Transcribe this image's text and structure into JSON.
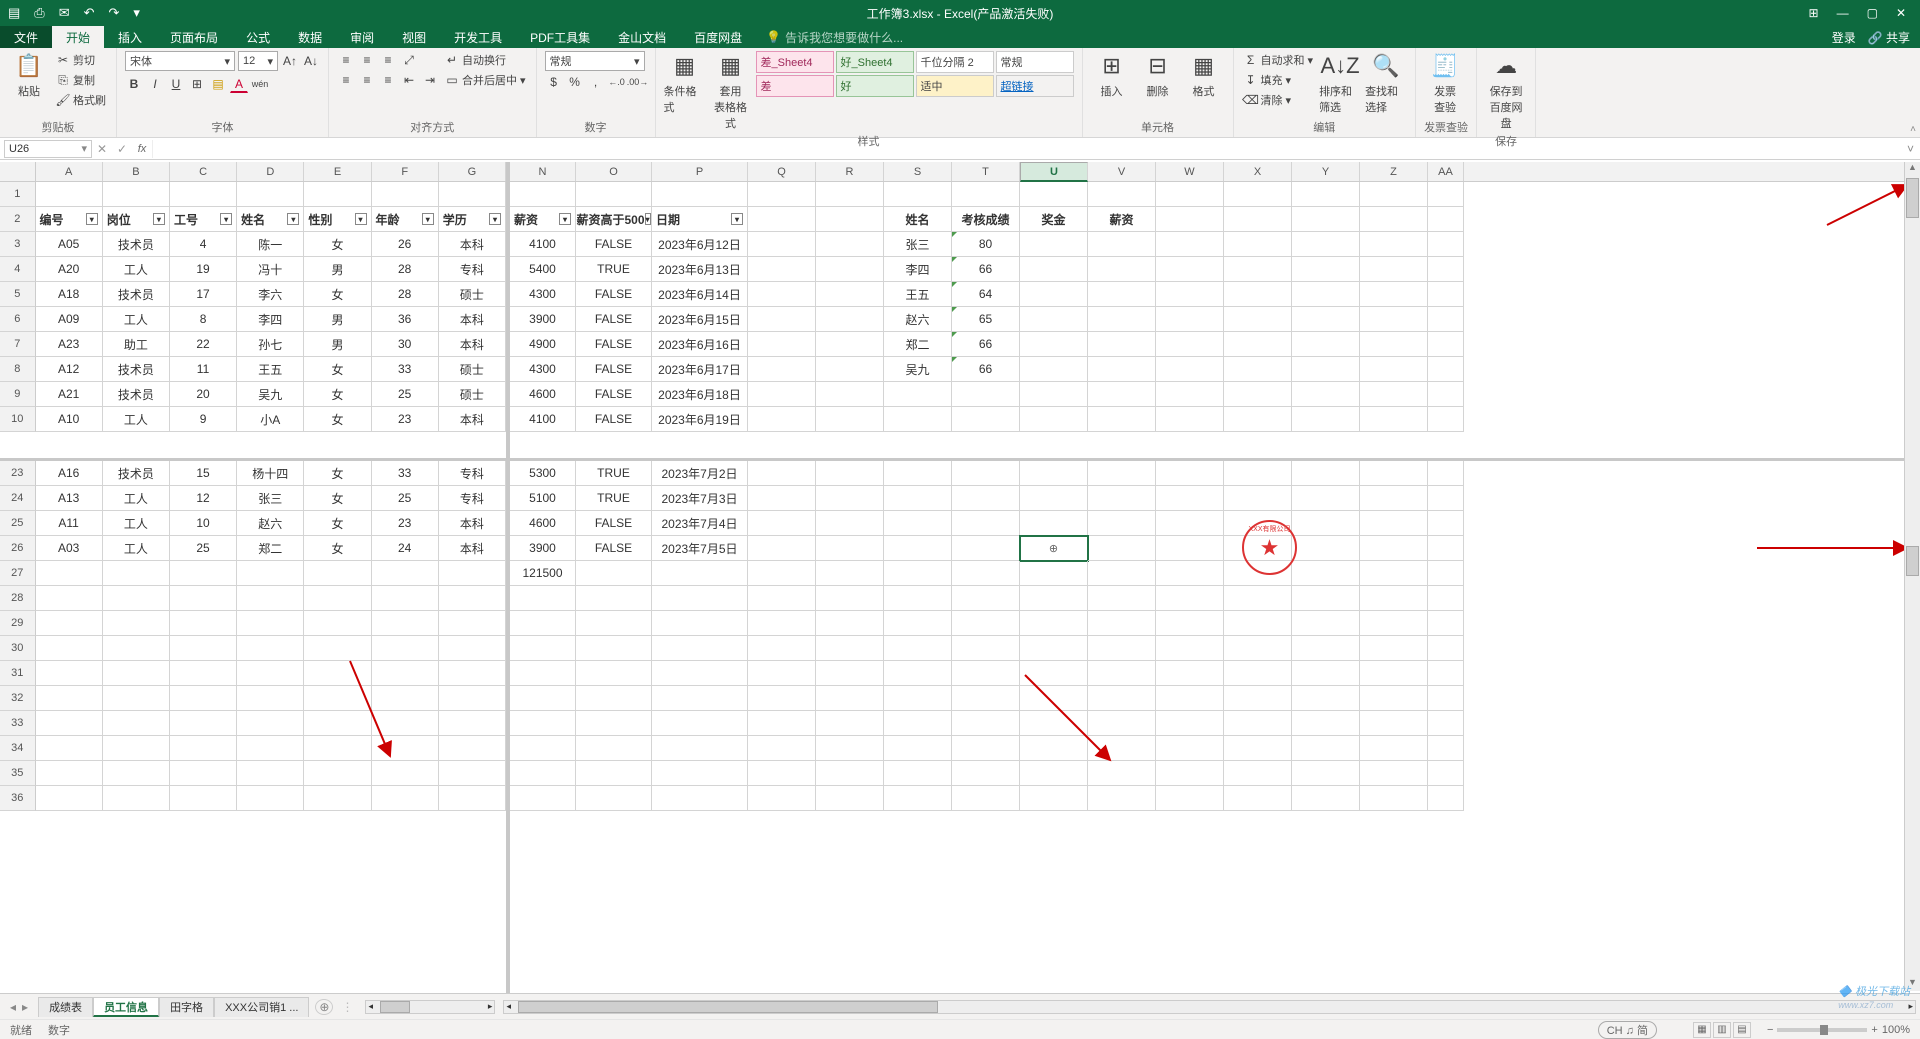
{
  "app": {
    "title": "工作簿3.xlsx - Excel(产品激活失败)",
    "qa_save": "▤",
    "qa_touch": "⎙",
    "qa_print": "✉",
    "qa_undo": "↶",
    "qa_redo": "↷",
    "qa_more": "▾",
    "win_ribbonopt": "⊞",
    "win_min": "—",
    "win_max": "▢",
    "win_close": "✕"
  },
  "tabs": {
    "file": "文件",
    "home": "开始",
    "insert": "插入",
    "layout": "页面布局",
    "formula": "公式",
    "data": "数据",
    "review": "审阅",
    "view": "视图",
    "dev": "开发工具",
    "pdf": "PDF工具集",
    "kingsoft": "金山文档",
    "baidu": "百度网盘",
    "tell_icon": "💡",
    "tell_placeholder": "告诉我您想要做什么...",
    "login": "登录",
    "share": "共享"
  },
  "ribbon": {
    "clipboard": {
      "paste": "粘贴",
      "cut": "剪切",
      "copy": "复制",
      "painter": "格式刷",
      "label": "剪贴板"
    },
    "font": {
      "name": "宋体",
      "size": "12",
      "bold": "B",
      "italic": "I",
      "underline": "U",
      "border": "⊞",
      "fill": "▤",
      "color": "A",
      "inc": "A↑",
      "dec": "A↓",
      "pinyin": "拼音",
      "label": "字体"
    },
    "align": {
      "wrap": "自动换行",
      "merge": "合并后居中",
      "label": "对齐方式"
    },
    "number": {
      "fmt": "常规",
      "cur": "$",
      "pct": "%",
      "comma": ",",
      "inc": ".0",
      "dec": ".00",
      "label": "数字"
    },
    "styles": {
      "cond": "条件格式",
      "astable": "套用\n表格格式",
      "s1": "差_Sheet4",
      "s2": "好_Sheet4",
      "s3": "千位分隔 2",
      "s4": "常规",
      "s5": "差",
      "s6": "好",
      "s7": "适中",
      "s8": "超链接",
      "label": "样式"
    },
    "cells": {
      "insert": "插入",
      "delete": "删除",
      "format": "格式",
      "label": "单元格"
    },
    "editing": {
      "sum": "自动求和",
      "fill": "填充",
      "clear": "清除",
      "sort": "排序和筛选",
      "find": "查找和选择",
      "label": "编辑"
    },
    "invoice": {
      "btn": "发票\n查验",
      "label": "发票查验"
    },
    "save": {
      "btn": "保存到\n百度网盘",
      "label": "保存"
    }
  },
  "formula_bar": {
    "name_box": "U26",
    "fx": "fx"
  },
  "columns_left": [
    "A",
    "B",
    "C",
    "D",
    "E",
    "F",
    "G"
  ],
  "columns_right": [
    "N",
    "O",
    "P",
    "Q",
    "R",
    "S",
    "T",
    "U",
    "V",
    "W",
    "X",
    "Y",
    "Z",
    "AA"
  ],
  "row_headers_top": [
    "1",
    "2",
    "3",
    "4",
    "5",
    "6",
    "7",
    "8",
    "9",
    "10"
  ],
  "row_headers_bottom": [
    "23",
    "24",
    "25",
    "26",
    "27",
    "28",
    "29",
    "30",
    "31",
    "32",
    "33",
    "34",
    "35",
    "36"
  ],
  "left_headers": {
    "A": "编号",
    "B": "岗位",
    "C": "工号",
    "D": "姓名",
    "E": "性别",
    "F": "年龄",
    "G": "学历"
  },
  "left_rows_top": [
    {
      "A": "A05",
      "B": "技术员",
      "C": "4",
      "D": "陈一",
      "E": "女",
      "F": "26",
      "G": "本科"
    },
    {
      "A": "A20",
      "B": "工人",
      "C": "19",
      "D": "冯十",
      "E": "男",
      "F": "28",
      "G": "专科"
    },
    {
      "A": "A18",
      "B": "技术员",
      "C": "17",
      "D": "李六",
      "E": "女",
      "F": "28",
      "G": "硕士"
    },
    {
      "A": "A09",
      "B": "工人",
      "C": "8",
      "D": "李四",
      "E": "男",
      "F": "36",
      "G": "本科"
    },
    {
      "A": "A23",
      "B": "助工",
      "C": "22",
      "D": "孙七",
      "E": "男",
      "F": "30",
      "G": "本科"
    },
    {
      "A": "A12",
      "B": "技术员",
      "C": "11",
      "D": "王五",
      "E": "女",
      "F": "33",
      "G": "硕士"
    },
    {
      "A": "A21",
      "B": "技术员",
      "C": "20",
      "D": "吴九",
      "E": "女",
      "F": "25",
      "G": "硕士"
    },
    {
      "A": "A10",
      "B": "工人",
      "C": "9",
      "D": "小A",
      "E": "女",
      "F": "23",
      "G": "本科"
    }
  ],
  "left_rows_bottom": [
    {
      "A": "A16",
      "B": "技术员",
      "C": "15",
      "D": "杨十四",
      "E": "女",
      "F": "33",
      "G": "专科"
    },
    {
      "A": "A13",
      "B": "工人",
      "C": "12",
      "D": "张三",
      "E": "女",
      "F": "25",
      "G": "专科"
    },
    {
      "A": "A11",
      "B": "工人",
      "C": "10",
      "D": "赵六",
      "E": "女",
      "F": "23",
      "G": "本科"
    },
    {
      "A": "A03",
      "B": "工人",
      "C": "25",
      "D": "郑二",
      "E": "女",
      "F": "24",
      "G": "本科"
    }
  ],
  "right_headers": {
    "N": "薪资",
    "O": "薪资高于500",
    "P": "日期",
    "S": "姓名",
    "T": "考核成绩",
    "U": "奖金",
    "V": "薪资"
  },
  "right_rows_top": [
    {
      "N": "4100",
      "O": "FALSE",
      "P": "2023年6月12日",
      "S": "张三",
      "T": "80"
    },
    {
      "N": "5400",
      "O": "TRUE",
      "P": "2023年6月13日",
      "S": "李四",
      "T": "66"
    },
    {
      "N": "4300",
      "O": "FALSE",
      "P": "2023年6月14日",
      "S": "王五",
      "T": "64"
    },
    {
      "N": "3900",
      "O": "FALSE",
      "P": "2023年6月15日",
      "S": "赵六",
      "T": "65"
    },
    {
      "N": "4900",
      "O": "FALSE",
      "P": "2023年6月16日",
      "S": "郑二",
      "T": "66"
    },
    {
      "N": "4300",
      "O": "FALSE",
      "P": "2023年6月17日",
      "S": "吴九",
      "T": "66"
    },
    {
      "N": "4600",
      "O": "FALSE",
      "P": "2023年6月18日"
    },
    {
      "N": "4100",
      "O": "FALSE",
      "P": "2023年6月19日"
    }
  ],
  "right_rows_bottom": [
    {
      "N": "5300",
      "O": "TRUE",
      "P": "2023年7月2日"
    },
    {
      "N": "5100",
      "O": "TRUE",
      "P": "2023年7月3日"
    },
    {
      "N": "4600",
      "O": "FALSE",
      "P": "2023年7月4日"
    },
    {
      "N": "3900",
      "O": "FALSE",
      "P": "2023年7月5日"
    },
    {
      "N": "121500"
    }
  ],
  "sheets": {
    "s1": "成绩表",
    "s2": "员工信息",
    "s3": "田字格",
    "s4": "XXX公司销1",
    "add": "⊕"
  },
  "status": {
    "ready": "就绪",
    "numlock": "数字",
    "ime": "CH ♫ 简",
    "zoom": "100%"
  },
  "watermark": "极光下载站"
}
